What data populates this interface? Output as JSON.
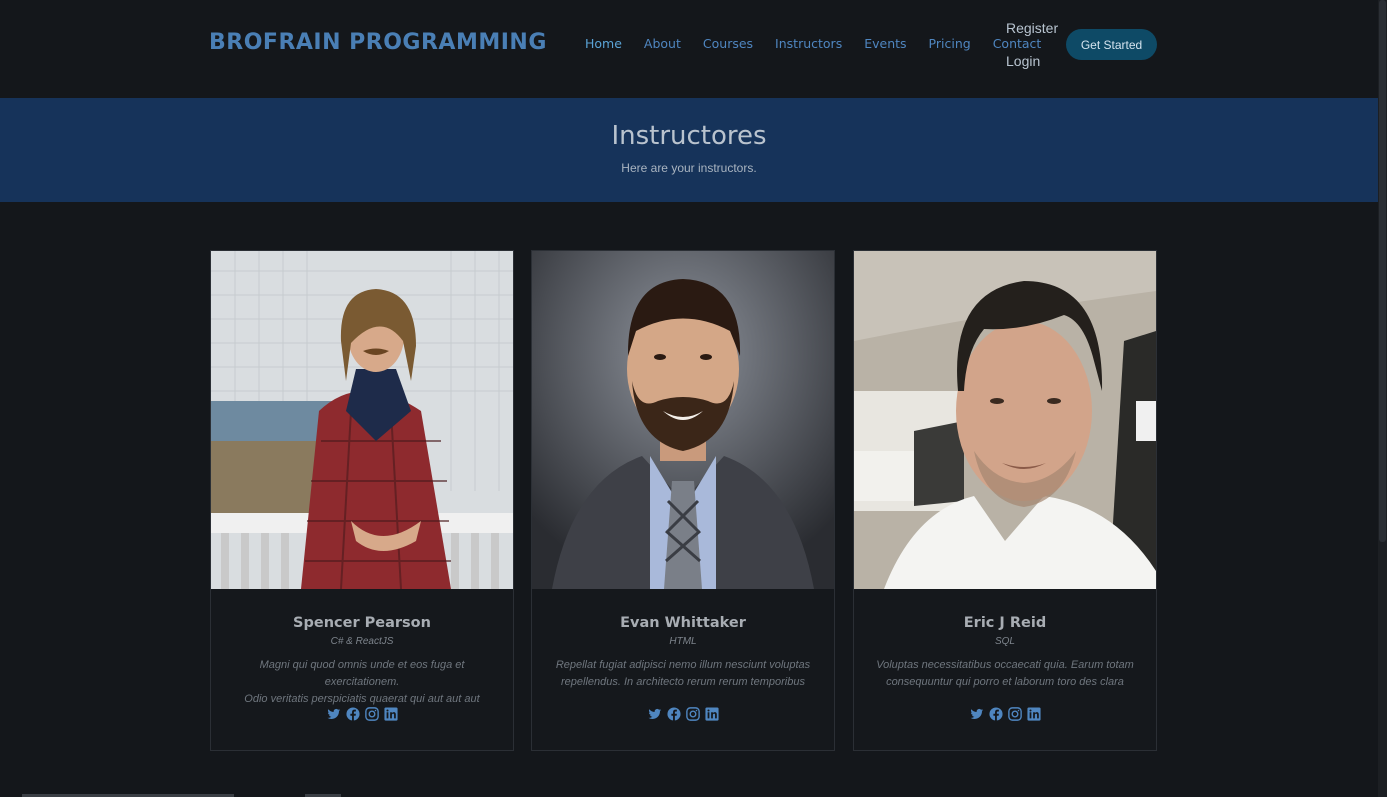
{
  "header": {
    "logo": "BROFRAIN PROGRAMMING",
    "nav": [
      "Home",
      "About",
      "Courses",
      "Instructors",
      "Events",
      "Pricing",
      "Contact"
    ],
    "active": "Home",
    "register": "Register",
    "login": "Login",
    "cta": "Get Started",
    "accent_color": "#4f86c0"
  },
  "banner": {
    "title": "Instructores",
    "subtitle": "Here are your instructors.",
    "background": "#16335a"
  },
  "instructors": [
    {
      "name": "Spencer Pearson",
      "role": "C# & ReactJS",
      "bio_line1": "Magni qui quod omnis unde et eos fuga et exercitationem.",
      "bio_line2": "Odio veritatis perspiciatis quaerat qui aut aut aut",
      "photo": "man-long-hair-mustache-plaid-shirt-portrait"
    },
    {
      "name": "Evan Whittaker",
      "role": "HTML",
      "bio_line1": "Repellat fugiat adipisci nemo illum nesciunt voluptas",
      "bio_line2": "repellendus. In architecto rerum rerum temporibus",
      "photo": "man-beard-suit-tie-headshot"
    },
    {
      "name": "Eric J Reid",
      "role": "SQL",
      "bio_line1": "Voluptas necessitatibus occaecati quia. Earum totam",
      "bio_line2": "consequuntur qui porro et laborum toro des clara",
      "photo": "man-car-selfie-white-tshirt"
    }
  ],
  "social_icons": [
    "twitter-icon",
    "facebook-icon",
    "instagram-icon",
    "linkedin-icon"
  ]
}
